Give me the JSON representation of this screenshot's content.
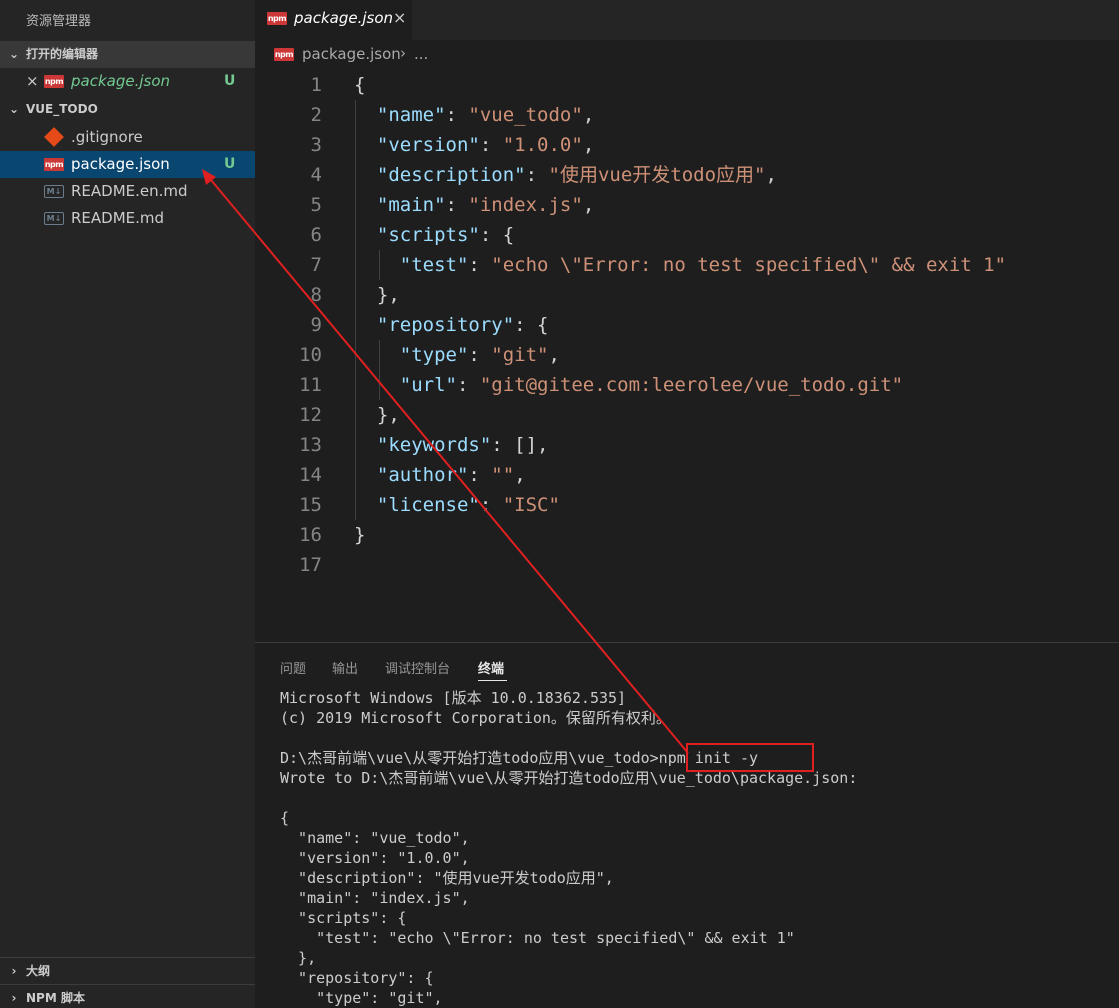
{
  "sidebar": {
    "title": "资源管理器",
    "open_editors": {
      "header": "打开的编辑器",
      "items": [
        {
          "close_glyph": "×",
          "label": "package.json",
          "status": "U"
        }
      ]
    },
    "project": {
      "header": "VUE_TODO",
      "files": [
        {
          "label": ".gitignore",
          "icon": "git-icon",
          "status": ""
        },
        {
          "label": "package.json",
          "icon": "npm-icon",
          "status": "U"
        },
        {
          "label": "README.en.md",
          "icon": "markdown-icon",
          "status": ""
        },
        {
          "label": "README.md",
          "icon": "markdown-icon",
          "status": ""
        }
      ]
    },
    "outline_header": "大纲",
    "npm_scripts_header": "NPM 脚本",
    "collapsed_chevron": "›",
    "expanded_chevron": "⌄"
  },
  "tab": {
    "label": "package.json",
    "close_glyph": "×"
  },
  "breadcrumb": {
    "file": "package.json",
    "separator": "›",
    "more": "..."
  },
  "editor": {
    "line_numbers": [
      "1",
      "2",
      "3",
      "4",
      "5",
      "6",
      "7",
      "8",
      "9",
      "10",
      "11",
      "12",
      "13",
      "14",
      "15",
      "16",
      "17"
    ],
    "lines": [
      [
        [
          "p",
          "{"
        ]
      ],
      [
        [
          "p",
          "  "
        ],
        [
          "k",
          "\"name\""
        ],
        [
          "p",
          ": "
        ],
        [
          "s",
          "\"vue_todo\""
        ],
        [
          "p",
          ","
        ]
      ],
      [
        [
          "p",
          "  "
        ],
        [
          "k",
          "\"version\""
        ],
        [
          "p",
          ": "
        ],
        [
          "s",
          "\"1.0.0\""
        ],
        [
          "p",
          ","
        ]
      ],
      [
        [
          "p",
          "  "
        ],
        [
          "k",
          "\"description\""
        ],
        [
          "p",
          ": "
        ],
        [
          "s",
          "\"使用vue开发todo应用\""
        ],
        [
          "p",
          ","
        ]
      ],
      [
        [
          "p",
          "  "
        ],
        [
          "k",
          "\"main\""
        ],
        [
          "p",
          ": "
        ],
        [
          "s",
          "\"index.js\""
        ],
        [
          "p",
          ","
        ]
      ],
      [
        [
          "p",
          "  "
        ],
        [
          "k",
          "\"scripts\""
        ],
        [
          "p",
          ": {"
        ]
      ],
      [
        [
          "p",
          "    "
        ],
        [
          "k",
          "\"test\""
        ],
        [
          "p",
          ": "
        ],
        [
          "s",
          "\"echo \\\"Error: no test specified\\\" && exit 1\""
        ]
      ],
      [
        [
          "p",
          "  },"
        ]
      ],
      [
        [
          "p",
          "  "
        ],
        [
          "k",
          "\"repository\""
        ],
        [
          "p",
          ": {"
        ]
      ],
      [
        [
          "p",
          "    "
        ],
        [
          "k",
          "\"type\""
        ],
        [
          "p",
          ": "
        ],
        [
          "s",
          "\"git\""
        ],
        [
          "p",
          ","
        ]
      ],
      [
        [
          "p",
          "    "
        ],
        [
          "k",
          "\"url\""
        ],
        [
          "p",
          ": "
        ],
        [
          "s",
          "\"git@gitee.com:leerolee/vue_todo.git\""
        ]
      ],
      [
        [
          "p",
          "  },"
        ]
      ],
      [
        [
          "p",
          "  "
        ],
        [
          "k",
          "\"keywords\""
        ],
        [
          "p",
          ": [],"
        ]
      ],
      [
        [
          "p",
          "  "
        ],
        [
          "k",
          "\"author\""
        ],
        [
          "p",
          ": "
        ],
        [
          "s",
          "\"\""
        ],
        [
          "p",
          ","
        ]
      ],
      [
        [
          "p",
          "  "
        ],
        [
          "k",
          "\"license\""
        ],
        [
          "p",
          ": "
        ],
        [
          "s",
          "\"ISC\""
        ]
      ],
      [
        [
          "p",
          "}"
        ]
      ],
      [
        [
          "p",
          ""
        ]
      ]
    ]
  },
  "panel": {
    "tabs": [
      "问题",
      "输出",
      "调试控制台",
      "终端"
    ],
    "active_tab": "终端",
    "terminal_lines": [
      "Microsoft Windows [版本 10.0.18362.535]",
      "(c) 2019 Microsoft Corporation。保留所有权利。",
      "",
      "D:\\杰哥前端\\vue\\从零开始打造todo应用\\vue_todo>npm init -y",
      "Wrote to D:\\杰哥前端\\vue\\从零开始打造todo应用\\vue_todo\\package.json:",
      "",
      "{",
      "  \"name\": \"vue_todo\",",
      "  \"version\": \"1.0.0\",",
      "  \"description\": \"使用vue开发todo应用\",",
      "  \"main\": \"index.js\",",
      "  \"scripts\": {",
      "    \"test\": \"echo \\\"Error: no test specified\\\" && exit 1\"",
      "  },",
      "  \"repository\": {",
      "    \"type\": \"git\","
    ]
  },
  "colors": {
    "annotation_red": "#e02020",
    "selection": "#094771",
    "untracked_green": "#73c991",
    "json_key": "#9cdcfe",
    "json_string": "#ce9178"
  }
}
